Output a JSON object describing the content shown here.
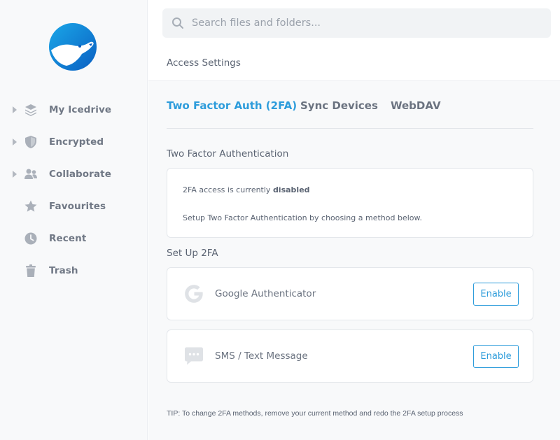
{
  "sidebar": {
    "logo": "icedrive-polar-bear-logo",
    "items": [
      {
        "label": "My Icedrive",
        "icon": "layers-icon",
        "has_caret": true
      },
      {
        "label": "Encrypted",
        "icon": "shield-icon",
        "has_caret": true
      },
      {
        "label": "Collaborate",
        "icon": "users-icon",
        "has_caret": true
      },
      {
        "label": "Favourites",
        "icon": "star-icon",
        "has_caret": false
      },
      {
        "label": "Recent",
        "icon": "clock-icon",
        "has_caret": false
      },
      {
        "label": "Trash",
        "icon": "trash-icon",
        "has_caret": false
      }
    ]
  },
  "search": {
    "placeholder": "Search files and folders..."
  },
  "page": {
    "title": "Access Settings"
  },
  "tabs": [
    {
      "label": "Two Factor Auth (2FA)",
      "active": true
    },
    {
      "label": "Sync Devices",
      "active": false
    },
    {
      "label": "WebDAV",
      "active": false
    }
  ],
  "twofa": {
    "section_title": "Two Factor Authentication",
    "status_prefix": "2FA access is currently ",
    "status_value": "disabled",
    "setup_hint": "Setup Two Factor Authentication by choosing a method below.",
    "setup_title": "Set Up 2FA",
    "methods": [
      {
        "label": "Google Authenticator",
        "icon": "google-icon",
        "button": "Enable"
      },
      {
        "label": "SMS / Text Message",
        "icon": "sms-icon",
        "button": "Enable"
      }
    ],
    "tip": "TIP: To change 2FA methods, remove your current method and redo the 2FA setup process"
  },
  "colors": {
    "accent": "#2d9cdb",
    "sidebar_bg": "#f8f9fa",
    "icon_gray": "#aab0b9"
  }
}
